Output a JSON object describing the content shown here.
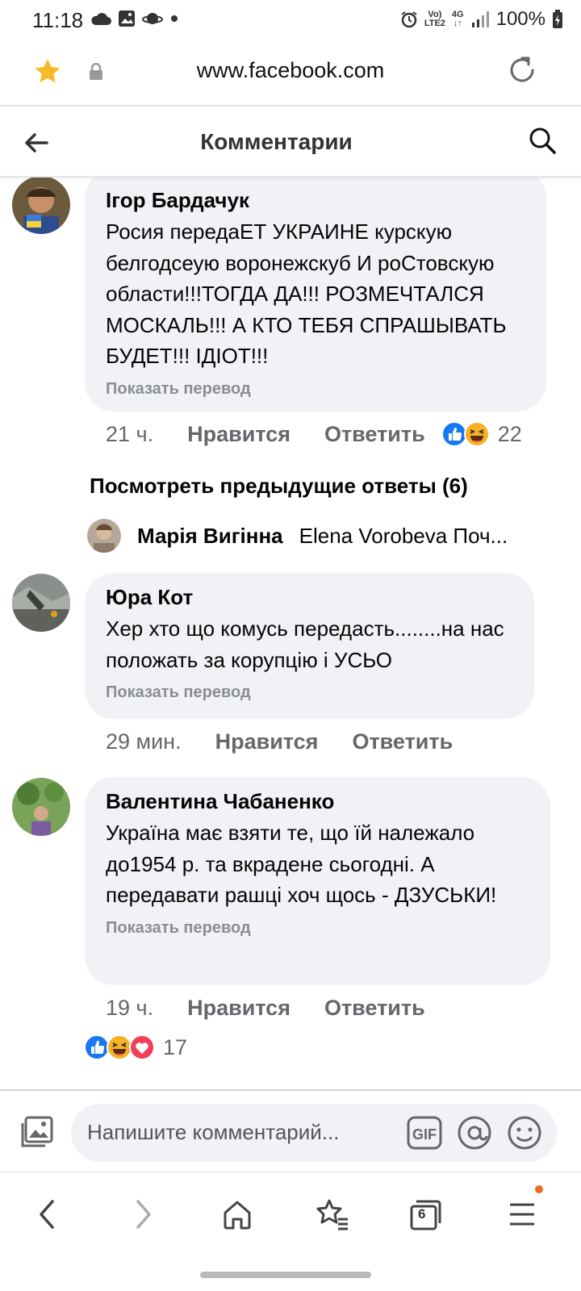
{
  "status_bar": {
    "time": "11:18",
    "network_top": "Vo)",
    "network_bottom": "LTE2",
    "gen_top": "4G",
    "gen_bottom": "↓↑",
    "battery": "100%"
  },
  "browser": {
    "url": "www.facebook.com"
  },
  "header": {
    "title": "Комментарии"
  },
  "comments": [
    {
      "author": "Ігор Бардачук",
      "text": "Росия передаЕТ УКРАИНЕ курскую белгодсеую воронежскуб И роСтовскую области!!!ТОГДА ДА!!! РОЗМЕЧТАЛСЯ МОСКАЛЬ!!! А КТО ТЕБЯ СПРАШЫВАТЬ БУДЕТ!!!  ІДІОТ!!!",
      "translate": "Показать перевод",
      "time": "21 ч.",
      "like": "Нравится",
      "reply": "Ответить",
      "reactions": [
        "like",
        "haha"
      ],
      "reaction_count": "22"
    },
    {
      "author": "Юра Кот",
      "text": "Хер хто що комусь передасть........на нас положать за корупцію і УСЬО",
      "translate": "Показать перевод",
      "time": "29 мин.",
      "like": "Нравится",
      "reply": "Ответить"
    },
    {
      "author": "Валентина Чабаненко",
      "text": "Україна має взяти те, що їй належало до1954 р. та вкрадене сьогодні. А передавати рашці хоч щось - ДЗУСЬКИ!",
      "translate": "Показать перевод",
      "time": "19 ч.",
      "like": "Нравится",
      "reply": "Ответить",
      "reactions": [
        "like",
        "haha",
        "love"
      ],
      "reaction_count": "17"
    }
  ],
  "previous_replies": "Посмотреть предыдущие ответы (6)",
  "reply_preview": {
    "author": "Марія Вигінна",
    "text": "Elena Vorobeva Поч..."
  },
  "composer": {
    "placeholder": "Напишите комментарий...",
    "gif_label": "GIF"
  },
  "bottom_nav": {
    "tab_count": "6"
  },
  "colors": {
    "bubble": "#f0f2f5",
    "meta_text": "#65676b",
    "like_blue": "#1877f2",
    "love_red": "#f33e58",
    "haha_yellow": "#f7b125",
    "star": "#f7b928"
  }
}
